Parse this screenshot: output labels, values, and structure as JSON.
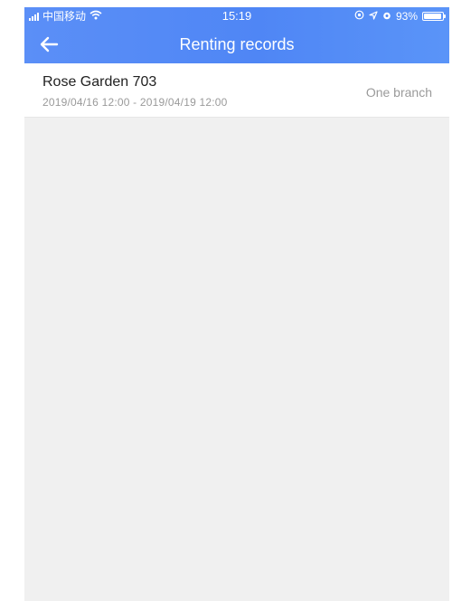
{
  "status_bar": {
    "carrier": "中国移动",
    "time": "15:19",
    "battery_percent_text": "93%",
    "battery_level": 0.93,
    "icons": [
      "signal-icon",
      "wifi-icon",
      "location-icon",
      "navigation-icon",
      "alarm-icon",
      "battery-icon"
    ]
  },
  "header": {
    "title": "Renting records",
    "back_icon": "back-arrow-icon"
  },
  "records": [
    {
      "name": "Rose Garden 703",
      "period": "2019/04/16 12:00 - 2019/04/19 12:00",
      "branch": "One branch"
    }
  ],
  "colors": {
    "header_blue": "#4f86f5",
    "page_background": "#f0f0f0",
    "secondary_text": "#9a9a9a"
  }
}
